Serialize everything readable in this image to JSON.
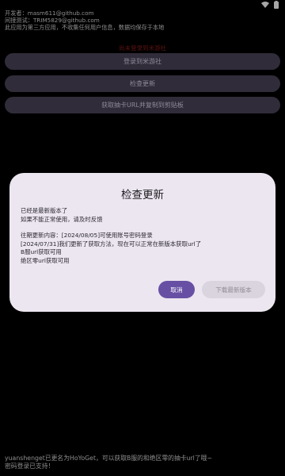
{
  "status_bar": {
    "wifi_icon": "wifi-icon",
    "battery_icon": "battery-icon"
  },
  "info": {
    "developer": "开发者：masm611@github.com",
    "tester": "间接测试：TRIM5829@github.com",
    "disclaimer": "此应用为第三方应用，不收集任何用户信息，数据均保存于本地"
  },
  "warning": "尚未登录到米游社",
  "buttons": {
    "login": "登录到米游社",
    "check_update": "检查更新",
    "get_gacha_url": "获取抽卡URL并复制到剪贴板"
  },
  "dialog": {
    "title": "检查更新",
    "lines_top": [
      "已经是最新版本了",
      "如果不能正常使用，请及时反馈"
    ],
    "lines_history": [
      "往期更新内容：[2024/08/05]可使用账号密码登录",
      "[2024/07/31]我们更新了获取方法，现在可以正常在新版本获取url了",
      "B服url获取可用",
      "绝区零url获取可用"
    ],
    "cancel": "取消",
    "download": "下载最新版本"
  },
  "footer": {
    "line1": "yuanshenget已更名为HoYoGet，可以获取B服的和绝区零的抽卡url了哦~",
    "line2": "密码登录已支持！"
  },
  "colors": {
    "accent": "#6750a4",
    "button_bg": "#4a4458",
    "dialog_bg": "#ece6f0",
    "warning": "#8f1d1d"
  }
}
